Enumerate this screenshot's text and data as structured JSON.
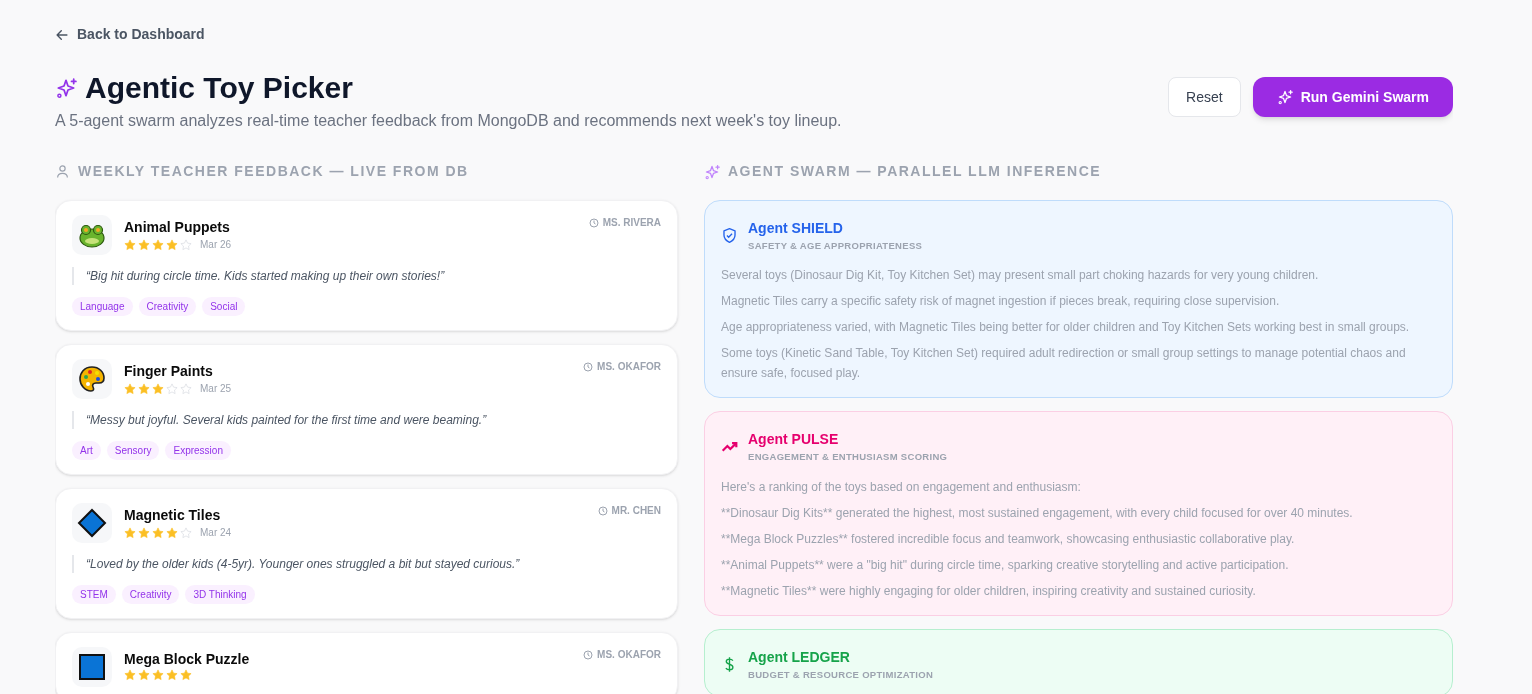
{
  "back_link": "Back to Dashboard",
  "title": "Agentic Toy Picker",
  "subtitle": "A 5-agent swarm analyzes real-time teacher feedback from MongoDB and recommends next week's toy lineup.",
  "buttons": [
    {
      "kind": "secondary",
      "label": "Reset"
    },
    {
      "kind": "primary",
      "label": "Run Gemini Swarm"
    }
  ],
  "feedback": {
    "heading": "WEEKLY TEACHER FEEDBACK — LIVE FROM DB",
    "items": [
      {
        "kind": "frog",
        "name": "Animal Puppets",
        "stars": 4,
        "date": "Mar 26",
        "teacher": "MS. RIVERA",
        "quote": "“Big hit during circle time. Kids started making up their own stories!”",
        "tags": [
          "Language",
          "Creativity",
          "Social"
        ]
      },
      {
        "kind": "palette",
        "name": "Finger Paints",
        "stars": 3,
        "date": "Mar 25",
        "teacher": "MS. OKAFOR",
        "quote": "“Messy but joyful. Several kids painted for the first time and were beaming.”",
        "tags": [
          "Art",
          "Sensory",
          "Expression"
        ]
      },
      {
        "kind": "diamond",
        "name": "Magnetic Tiles",
        "stars": 4,
        "date": "Mar 24",
        "teacher": "MR. CHEN",
        "quote": "“Loved by the older kids (4-5yr). Younger ones struggled a bit but stayed curious.”",
        "tags": [
          "STEM",
          "Creativity",
          "3D Thinking"
        ]
      },
      {
        "kind": "square",
        "name": "Mega Block Puzzle",
        "stars": 5,
        "teacher": "MS. OKAFOR"
      }
    ]
  },
  "swarm": {
    "heading": "AGENT SWARM — PARALLEL LLM INFERENCE",
    "agents": [
      {
        "kind": "shield",
        "color": "#2563eb",
        "name": "Agent SHIELD",
        "role": "SAFETY & AGE APPROPRIATENESS",
        "lines": [
          "Several toys (Dinosaur Dig Kit, Toy Kitchen Set) may present small part choking hazards for very young children.",
          "Magnetic Tiles carry a specific safety risk of magnet ingestion if pieces break, requiring close supervision.",
          "Age appropriateness varied, with Magnetic Tiles being better for older children and Toy Kitchen Sets working best in small groups.",
          "Some toys (Kinetic Sand Table, Toy Kitchen Set) required adult redirection or small group settings to manage potential chaos and ensure safe, focused play."
        ]
      },
      {
        "kind": "trend",
        "color": "#e6006e",
        "name": "Agent PULSE",
        "role": "ENGAGEMENT & ENTHUSIASM SCORING",
        "lines": [
          "Here's a ranking of the toys based on engagement and enthusiasm:",
          "**Dinosaur Dig Kits** generated the highest, most sustained engagement, with every child focused for over 40 minutes.",
          "**Mega Block Puzzles** fostered incredible focus and teamwork, showcasing enthusiastic collaborative play.",
          "**Animal Puppets** were a \"big hit\" during circle time, sparking creative storytelling and active participation.",
          "**Magnetic Tiles** were highly engaging for older children, inspiring creativity and sustained curiosity."
        ]
      },
      {
        "kind": "dollar",
        "color": "#16a34a",
        "name": "Agent LEDGER",
        "role": "BUDGET & RESOURCE OPTIMIZATION"
      }
    ]
  }
}
